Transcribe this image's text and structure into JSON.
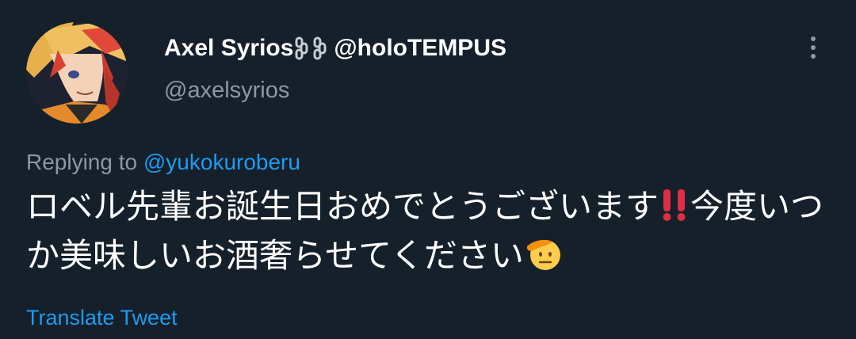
{
  "tweet": {
    "author": {
      "display_name": "Axel Syrios",
      "name_suffix": "@holoTEMPUS",
      "handle": "@axelsyrios",
      "avatar_icon": "anime-character-avatar",
      "name_emoji_icon": "chain-link-icon"
    },
    "replying_label": "Replying to",
    "replying_handle": "@yukokuroberu",
    "text_part1": "ロベル先輩お誕生日おめでとうございます",
    "text_emoji1_icon": "double-exclamation-icon",
    "text_part2": "今度いつか美味しいお酒奢らせてください",
    "text_emoji2_icon": "saluting-face-icon",
    "translate_label": "Translate Tweet",
    "more_icon": "vertical-ellipsis-icon"
  },
  "colors": {
    "background": "#15202b",
    "text_primary": "#ffffff",
    "text_secondary": "#8b98a5",
    "link": "#1d9bf0",
    "emoji_red": "#dd2e44",
    "emoji_yellow": "#ffcc4d"
  }
}
